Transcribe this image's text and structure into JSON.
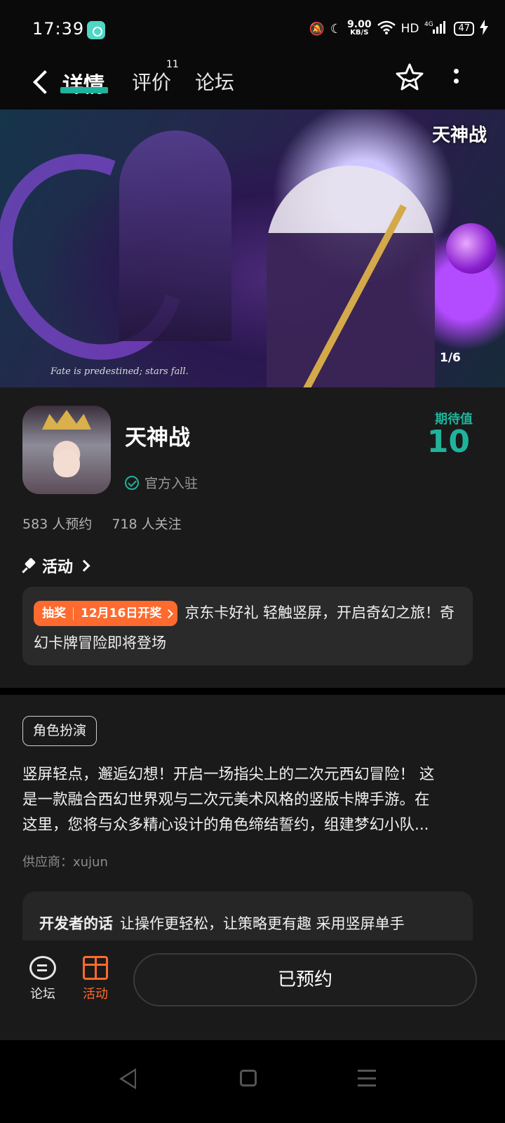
{
  "status_bar": {
    "time": "17:39",
    "net_speed_value": "9.00",
    "net_speed_unit": "KB/S",
    "network": "HD",
    "signal": "4G",
    "battery": "47",
    "icons": [
      "app-notification-icon",
      "mute-bell-icon",
      "moon-icon",
      "wifi-icon",
      "signal-bars-icon",
      "charging-icon"
    ]
  },
  "nav": {
    "tabs": [
      {
        "label": "详情",
        "active": true
      },
      {
        "label": "评价",
        "badge": "11"
      },
      {
        "label": "论坛"
      }
    ],
    "accent": "#1fb39b"
  },
  "banner": {
    "logo_text": "天神战",
    "caption": "Fate is predestined; stars fall.",
    "counter": "1/6"
  },
  "game": {
    "name": "天神战",
    "official_label": "官方入驻",
    "expect_label": "期待值",
    "expect_value": "10",
    "reservations": "583 人预约",
    "followers": "718 人关注"
  },
  "activity": {
    "heading": "活动",
    "badge_type": "抽奖",
    "badge_date": "12月16日开奖",
    "text": "京东卡好礼 轻触竖屏，开启奇幻之旅！奇幻卡牌冒险即将登场",
    "badge_color": "#ff6a2e"
  },
  "description": {
    "tag": "角色扮演",
    "line1": "竖屏轻点，邂逅幻想！开启一场指尖上的二次元西幻冒险！ 这",
    "line2": "是一款融合西幻世界观与二次元美术风格的竖版卡牌手游。在",
    "line3": "这里，您将与众多精心设计的角色缔结誓约，组建梦幻小队...",
    "supplier": "供应商：xujun",
    "dev_label": "开发者的话",
    "dev_text": "让操作更轻松，让策略更有趣 采用竖屏单手"
  },
  "action_bar": {
    "forum_label": "论坛",
    "events_label": "活动",
    "reserve_label": "已预约"
  }
}
